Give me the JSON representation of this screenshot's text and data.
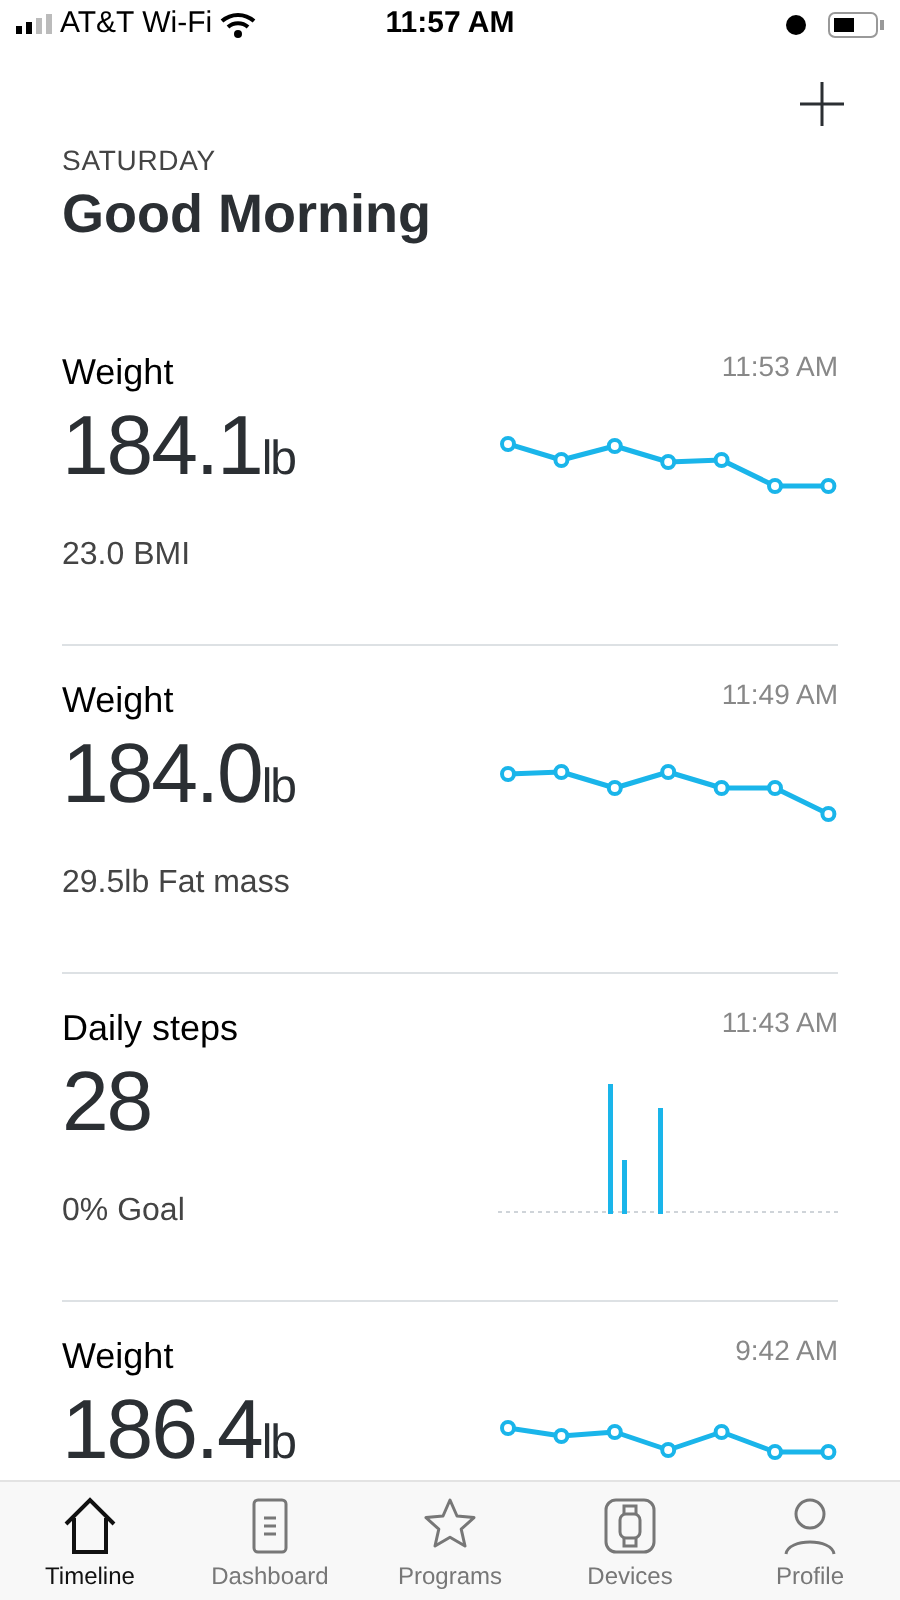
{
  "status_bar": {
    "carrier": "AT&T Wi-Fi",
    "time": "11:57 AM"
  },
  "header": {
    "day": "SATURDAY",
    "greeting": "Good Morning"
  },
  "cards": [
    {
      "kind": "line",
      "title": "Weight",
      "value": "184.1",
      "unit": "lb",
      "detail": "23.0 BMI",
      "time": "11:53 AM"
    },
    {
      "kind": "line",
      "title": "Weight",
      "value": "184.0",
      "unit": "lb",
      "detail": "29.5lb Fat mass",
      "time": "11:49 AM"
    },
    {
      "kind": "bars",
      "title": "Daily steps",
      "value": "28",
      "detail": "0% Goal",
      "time": "11:43 AM"
    },
    {
      "kind": "line",
      "title": "Weight",
      "value": "186.4",
      "unit": "lb",
      "time": "9:42 AM"
    }
  ],
  "tabs": [
    {
      "label": "Timeline",
      "selected": true
    },
    {
      "label": "Dashboard",
      "selected": false
    },
    {
      "label": "Programs",
      "selected": false
    },
    {
      "label": "Devices",
      "selected": false
    },
    {
      "label": "Profile",
      "selected": false
    }
  ]
}
